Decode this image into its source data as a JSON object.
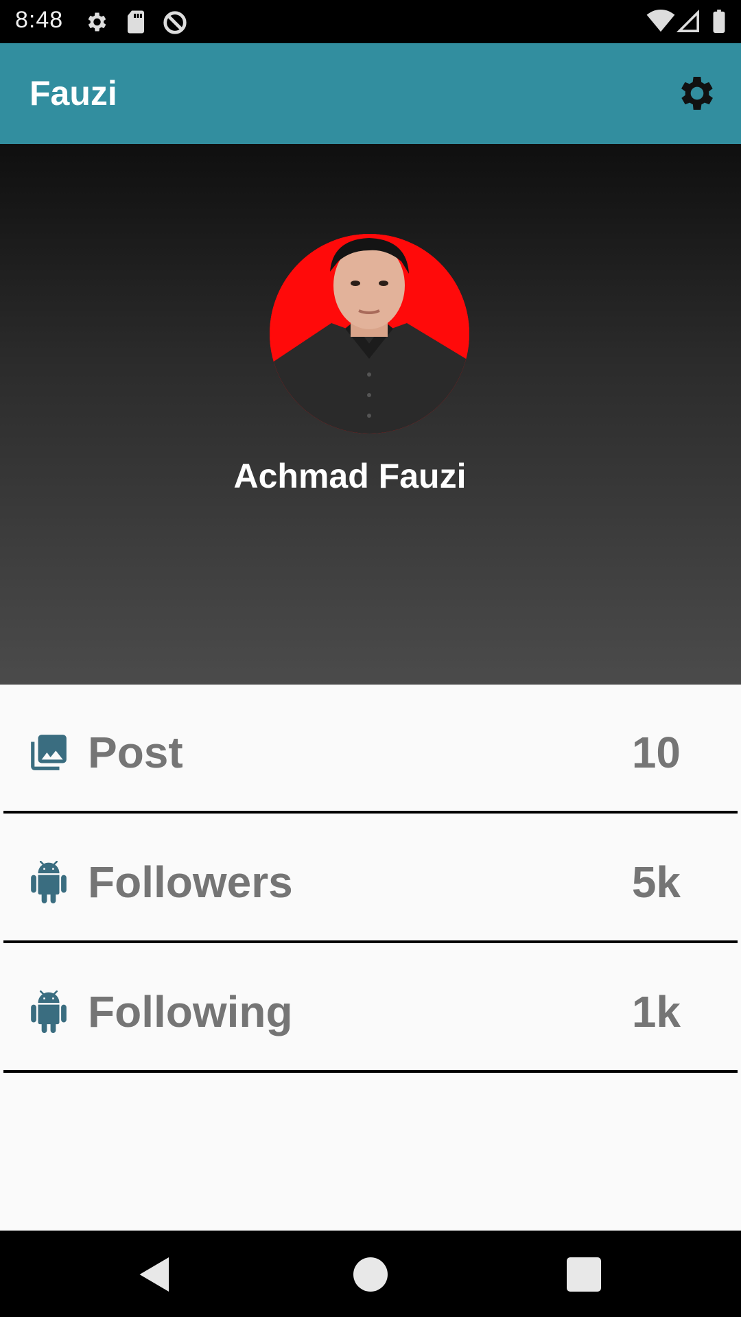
{
  "status_bar": {
    "time": "8:48",
    "icons": [
      "gear-icon",
      "sd-card-icon",
      "sync-disabled-icon",
      "wifi-icon",
      "signal-icon",
      "battery-icon"
    ]
  },
  "app_bar": {
    "title": "Fauzi",
    "background": "#328e9f",
    "action_icon": "settings-icon"
  },
  "profile": {
    "name": "Achmad Fauzi",
    "avatar_background": "#ff0a0a"
  },
  "stats": [
    {
      "icon": "photo-library-icon",
      "label": "Post",
      "value": "10"
    },
    {
      "icon": "android-icon",
      "label": "Followers",
      "value": "5k"
    },
    {
      "icon": "android-icon",
      "label": "Following",
      "value": "1k"
    }
  ],
  "colors": {
    "icon_tint": "#3a6d80",
    "label_text": "#757575"
  },
  "nav_bar": {
    "buttons": [
      "back-icon",
      "home-icon",
      "recents-icon"
    ]
  }
}
